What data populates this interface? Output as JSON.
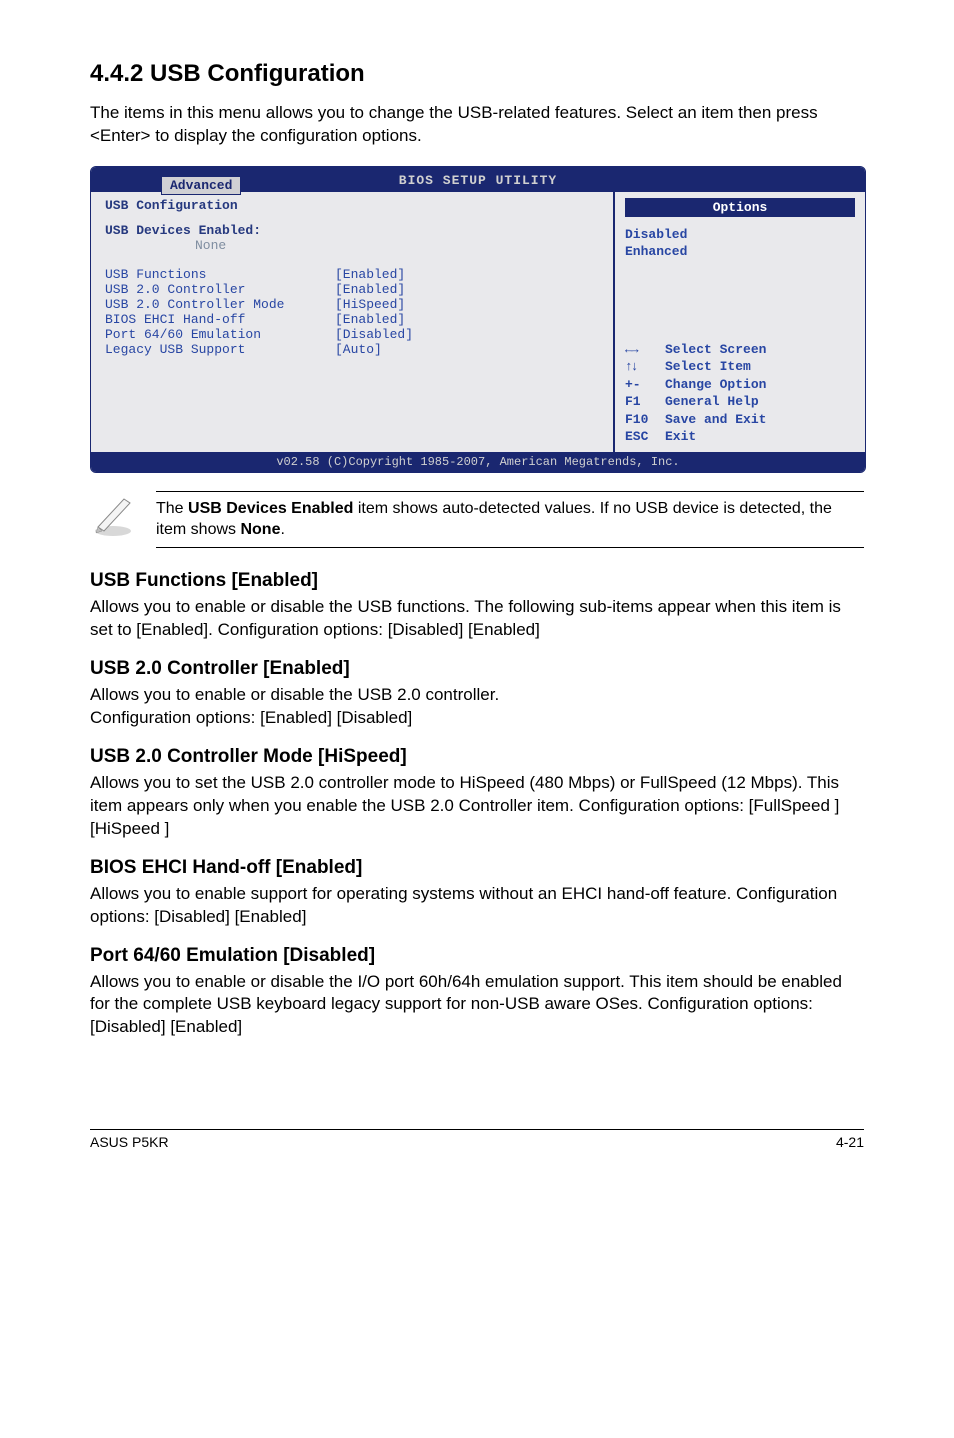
{
  "heading": "4.4.2      USB Configuration",
  "intro": "The items in this menu allows you to change the USB-related features. Select an item then press <Enter> to display the configuration options.",
  "bios": {
    "title": "BIOS SETUP UTILITY",
    "tab": "Advanced",
    "cfg_title": "USB Configuration",
    "devices_label": "USB Devices Enabled:",
    "devices_value": "None",
    "settings": [
      {
        "label": "USB Functions",
        "value": "[Enabled]"
      },
      {
        "label": "USB 2.0 Controller",
        "value": "[Enabled]"
      },
      {
        "label": "USB 2.0 Controller Mode",
        "value": "[HiSpeed]"
      },
      {
        "label": "BIOS EHCI Hand-off",
        "value": "[Enabled]"
      },
      {
        "label": "Port 64/60 Emulation",
        "value": "[Disabled]"
      },
      {
        "label": "Legacy USB Support",
        "value": "[Auto]"
      }
    ],
    "side": {
      "options_label": "Options",
      "opt1": "Disabled",
      "opt2": "Enhanced",
      "help": [
        {
          "key": "←→",
          "desc": "Select Screen"
        },
        {
          "key": "↑↓",
          "desc": "Select Item"
        },
        {
          "key": "+-",
          "desc": "Change Option"
        },
        {
          "key": "F1",
          "desc": "General Help"
        },
        {
          "key": "F10",
          "desc": "Save and Exit"
        },
        {
          "key": "ESC",
          "desc": "Exit"
        }
      ]
    },
    "footer": "v02.58 (C)Copyright 1985-2007, American Megatrends, Inc."
  },
  "note_before": "The ",
  "note_bold1": "USB Devices Enabled",
  "note_mid": " item shows auto-detected values. If no USB device is detected, the item shows ",
  "note_bold2": "None",
  "note_after": ".",
  "sections": [
    {
      "title": "USB Functions [Enabled]",
      "body": "Allows you to enable or disable the USB functions. The following sub-items appear when this item is set to [Enabled]. Configuration options: [Disabled] [Enabled]"
    },
    {
      "title": "USB 2.0 Controller [Enabled]",
      "body": "Allows you to enable or disable the USB 2.0 controller.\nConfiguration options: [Enabled] [Disabled]"
    },
    {
      "title": "USB 2.0 Controller Mode [HiSpeed]",
      "body": "Allows you to set the USB 2.0 controller mode to HiSpeed (480 Mbps) or FullSpeed (12 Mbps). This item appears only when you enable the USB 2.0 Controller item. Configuration options: [FullSpeed ] [HiSpeed ]"
    },
    {
      "title": "BIOS EHCI Hand-off [Enabled]",
      "body": "Allows you to enable support for operating systems without an EHCI hand-off feature. Configuration options: [Disabled] [Enabled]"
    },
    {
      "title": "Port 64/60 Emulation [Disabled]",
      "body": "Allows you to enable or disable the I/O port 60h/64h emulation support. This item should be enabled for the complete USB keyboard legacy support for non-USB aware OSes. Configuration options: [Disabled] [Enabled]"
    }
  ],
  "footer_left": "ASUS P5KR",
  "footer_right": "4-21"
}
